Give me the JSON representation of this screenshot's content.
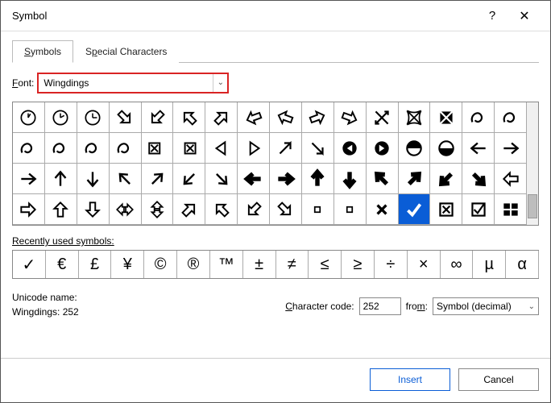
{
  "window": {
    "title": "Symbol"
  },
  "tabs": {
    "symbols": "Symbols",
    "special": "Special Characters"
  },
  "font": {
    "label": "Font:",
    "value": "Wingdings"
  },
  "grid": {
    "rows": [
      [
        "clock1",
        "clock2",
        "clock3",
        "arr-dr-hollow",
        "arr-dl-hollow",
        "arr-ul-hollow",
        "arr-ur-hollow",
        "arr-ld-hollow",
        "arr-lu-hollow",
        "arr-ru-hollow",
        "arr-rd-hollow",
        "arr-diagcross",
        "ornate-x",
        "ornate-square",
        "loop1",
        "loop2"
      ],
      [
        "loop3",
        "leaf1",
        "loop4",
        "loop5",
        "box-x-left",
        "box-x-right",
        "tri-w",
        "tri-e",
        "arrowcursor-ne",
        "arrowcursor-se",
        "ring-arrow-w",
        "ring-arrow-e",
        "half-up",
        "half-down",
        "arrow-w",
        "arrow-e"
      ],
      [
        "arrow-short-e",
        "arrow-n",
        "arrow-s",
        "arrow-nw",
        "arrow-ne",
        "arrow-sw",
        "arrow-se",
        "bold-w",
        "bold-e",
        "bold-n",
        "bold-s",
        "bold-nw",
        "bold-ne",
        "bold-sw",
        "bold-se",
        "hollow-w"
      ],
      [
        "hollow-e",
        "hollow-n",
        "hollow-s",
        "hollow-we",
        "hollow-ns",
        "hollow-ne",
        "hollow-nw",
        "hollow-sw",
        "hollow-se",
        "sq-small",
        "sq-small2",
        "x-mark",
        "check",
        "box-x",
        "box-check",
        "windows"
      ]
    ],
    "selected": [
      3,
      12
    ]
  },
  "recent": {
    "label": "Recently used symbols:",
    "items": [
      "✓",
      "€",
      "£",
      "¥",
      "©",
      "®",
      "™",
      "±",
      "≠",
      "≤",
      "≥",
      "÷",
      "×",
      "∞",
      "µ",
      "α"
    ]
  },
  "unicode": {
    "name_label": "Unicode name:",
    "name_value": "Wingdings: 252",
    "code_label": "Character code:",
    "code_value": "252",
    "from_label": "from:",
    "from_value": "Symbol (decimal)"
  },
  "buttons": {
    "insert": "Insert",
    "cancel": "Cancel"
  }
}
